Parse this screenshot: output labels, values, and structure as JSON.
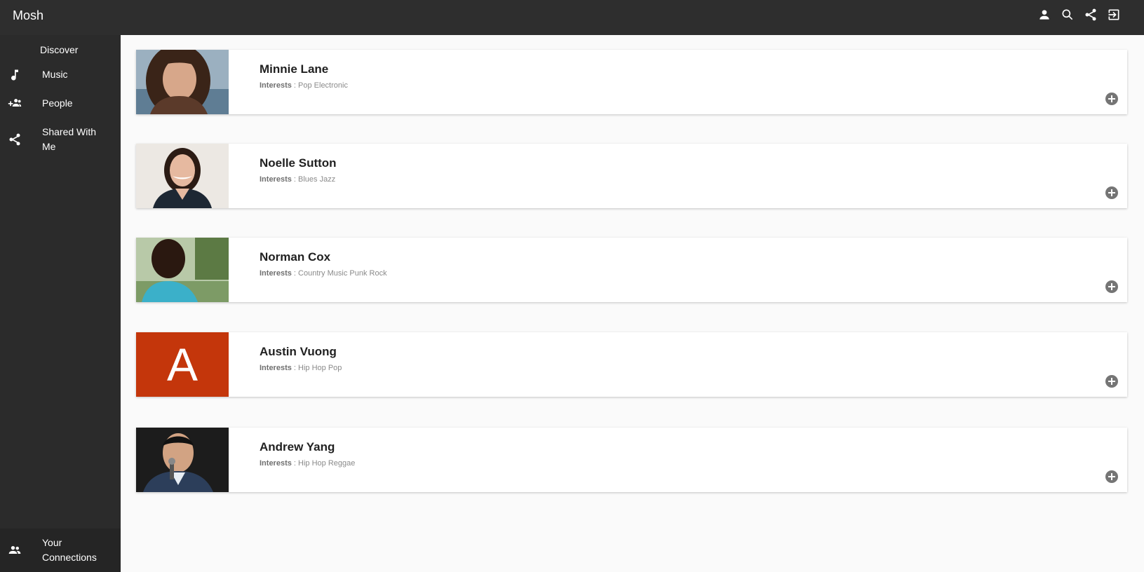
{
  "app": {
    "title": "Mosh"
  },
  "header": {
    "actions": [
      {
        "icon": "person-icon"
      },
      {
        "icon": "search-icon"
      },
      {
        "icon": "share-icon"
      },
      {
        "icon": "logout-icon"
      }
    ]
  },
  "sidebar": {
    "section_title": "Discover",
    "items": [
      {
        "label": "Music",
        "icon": "music-note-icon"
      },
      {
        "label": "People",
        "icon": "add-people-icon"
      },
      {
        "label": "Shared With Me",
        "icon": "share-icon"
      }
    ],
    "bottom_item": {
      "label": "Your Connections",
      "icon": "people-icon"
    }
  },
  "people": [
    {
      "name": "Minnie Lane",
      "interests_label": "Interests",
      "interests": "Pop Electronic",
      "avatar": "photo"
    },
    {
      "name": "Noelle Sutton",
      "interests_label": "Interests",
      "interests": "Blues Jazz",
      "avatar": "photo"
    },
    {
      "name": "Norman Cox",
      "interests_label": "Interests",
      "interests": "Country Music Punk Rock",
      "avatar": "photo"
    },
    {
      "name": "Austin Vuong",
      "interests_label": "Interests",
      "interests": "Hip Hop Pop",
      "avatar": "letter",
      "avatar_letter": "A"
    },
    {
      "name": "Andrew Yang",
      "interests_label": "Interests",
      "interests": "Hip Hop Reggae",
      "avatar": "photo"
    }
  ],
  "colors": {
    "topbar": "#2e2e2e",
    "sidebar": "#2b2b2b",
    "letter_avatar_bg": "#c4360b",
    "add_icon": "#757575"
  }
}
